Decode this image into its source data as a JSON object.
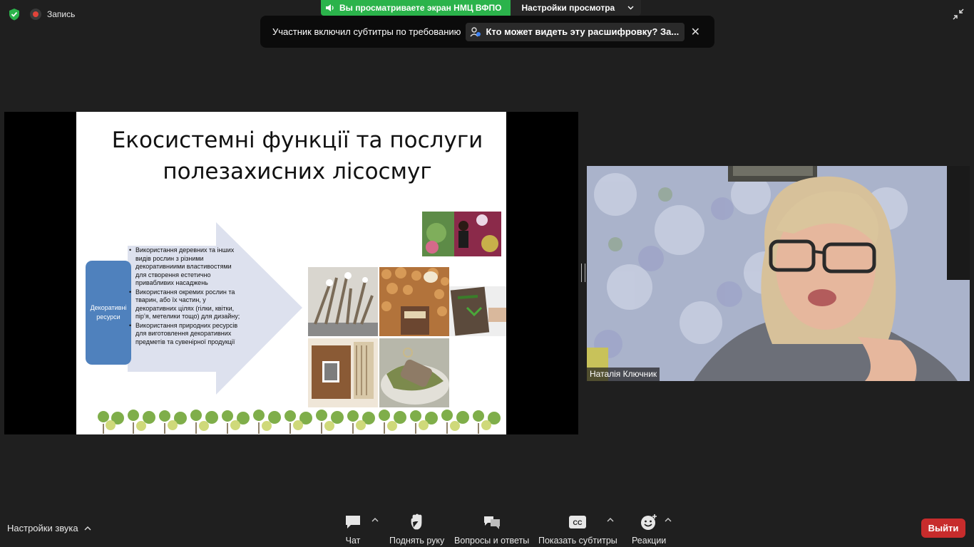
{
  "top": {
    "recording_label": "Запись",
    "share_banner_text": "Вы просматриваете экран НМЦ ВФПО",
    "view_options_label": "Настройки просмотра"
  },
  "caption_notice": {
    "text": "Участник включил субтитры по требованию",
    "link_text": "Кто может видеть эту расшифровку? За...",
    "close_symbol": "✕"
  },
  "slide": {
    "title_line1": "Екосистемні функції та послуги",
    "title_line2": "полезахисних лісосмуг",
    "box_label": "Декоративні ресурси",
    "bullets": [
      "Використання деревних та інших видів рослин з різними декоративниими властивостями для створення естетично привабливих насаджень",
      "Використання окремих рослин та тварин, або їх частин, у декоративних цілях (гілки, квітки, пір’я, метелики тощо) для дизайну;",
      "Використання природних ресурсів для виготовлення декоративних предметів та сувенірної продукції"
    ]
  },
  "video": {
    "participant_name": "Наталія Ключник"
  },
  "toolbar": {
    "audio_settings": "Настройки звука",
    "chat": "Чат",
    "raise_hand": "Поднять руку",
    "qa": "Вопросы и ответы",
    "captions": "Показать субтитры",
    "cc_badge": "CC",
    "reactions": "Реакции",
    "leave": "Выйти"
  },
  "colors": {
    "share_green": "#2bb34b",
    "leave_red": "#c72c2c",
    "slide_box_blue": "#4f81bd",
    "slide_arrow": "#dde1ee"
  }
}
